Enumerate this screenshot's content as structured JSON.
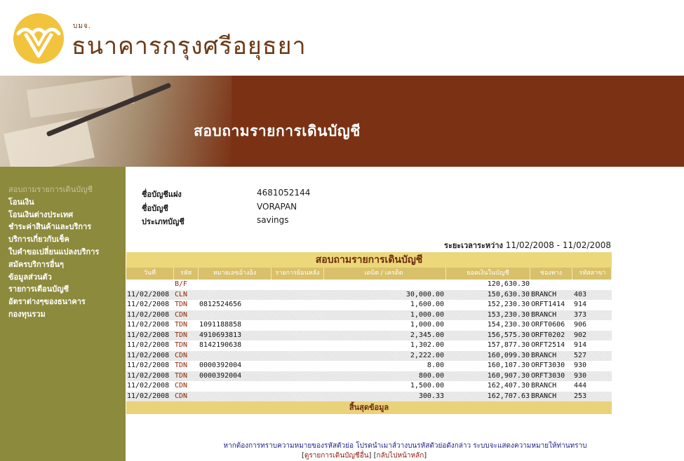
{
  "header": {
    "bank_prefix": "บมจ.",
    "bank_name": "ธนาคารกรุงศรีอยุธยา",
    "page_title": "สอบถามรายการเดินบัญชี",
    "logo_icon": "krungsri-logo-icon",
    "brand_color": "#7b3214",
    "logo_color": "#f2c33c"
  },
  "sidebar": {
    "items": [
      {
        "label": "สอบถามรายการเดินบัญชี",
        "active": true
      },
      {
        "label": "โอนเงิน"
      },
      {
        "label": "โอนเงินต่างประเทศ"
      },
      {
        "label": "ชำระค่าสินค้าและบริการ"
      },
      {
        "label": "บริการเกี่ยวกับเช็ค"
      },
      {
        "label": "ใบคำขอเปลี่ยนแปลงบริการ"
      },
      {
        "label": "สมัครบริการอื่นๆ"
      },
      {
        "label": "ข้อมูลส่วนตัว"
      },
      {
        "label": "รายการเตือนบัญชี"
      },
      {
        "label": "อัตราต่างๆของธนาคาร"
      },
      {
        "label": "กองทุนรวม"
      }
    ]
  },
  "account": {
    "nickname_label": "ชื่อบัญชีแฝง",
    "nickname_value": "4681052144",
    "name_label": "ชื่อบัญชี",
    "name_value": "VORAPAN",
    "type_label": "ประเภทบัญชี",
    "type_value": "savings"
  },
  "period": {
    "label": "ระยะเวลาระหว่าง",
    "value": "11/02/2008 - 11/02/2008"
  },
  "statement": {
    "title": "สอบถามรายการเดินบัญชี",
    "columns": [
      "วันที่",
      "รหัส",
      "หมายเลขอ้างอิง",
      "รายการย้อนหลัง",
      "เดบิต / เครดิต",
      "ยอดเงินในบัญชี",
      "ช่องทาง",
      "รหัสสาขา"
    ],
    "rows": [
      {
        "date": "",
        "code": "B/F",
        "ref": "",
        "rev": "",
        "amount": "",
        "balance": "120,630.30",
        "channel": "",
        "branch": ""
      },
      {
        "date": "11/02/2008",
        "code": "CLN",
        "ref": "",
        "rev": "",
        "amount": "30,000.00",
        "balance": "150,630.30",
        "channel": "BRANCH",
        "branch": "403"
      },
      {
        "date": "11/02/2008",
        "code": "TDN",
        "ref": "0812524656",
        "rev": "",
        "amount": "1,600.00",
        "balance": "152,230.30",
        "channel": "ORFT1414",
        "branch": "914"
      },
      {
        "date": "11/02/2008",
        "code": "CDN",
        "ref": "",
        "rev": "",
        "amount": "1,000.00",
        "balance": "153,230.30",
        "channel": "BRANCH",
        "branch": "373"
      },
      {
        "date": "11/02/2008",
        "code": "TDN",
        "ref": "1091188858",
        "rev": "",
        "amount": "1,000.00",
        "balance": "154,230.30",
        "channel": "ORFT0606",
        "branch": "906"
      },
      {
        "date": "11/02/2008",
        "code": "TDN",
        "ref": "4910693813",
        "rev": "",
        "amount": "2,345.00",
        "balance": "156,575.30",
        "channel": "ORFT0202",
        "branch": "902"
      },
      {
        "date": "11/02/2008",
        "code": "TDN",
        "ref": "8142190638",
        "rev": "",
        "amount": "1,302.00",
        "balance": "157,877.30",
        "channel": "ORFT2514",
        "branch": "914"
      },
      {
        "date": "11/02/2008",
        "code": "CDN",
        "ref": "",
        "rev": "",
        "amount": "2,222.00",
        "balance": "160,099.30",
        "channel": "BRANCH",
        "branch": "527"
      },
      {
        "date": "11/02/2008",
        "code": "TDN",
        "ref": "0000392004",
        "rev": "",
        "amount": "8.00",
        "balance": "160,107.30",
        "channel": "ORFT3030",
        "branch": "930"
      },
      {
        "date": "11/02/2008",
        "code": "TDN",
        "ref": "0000392004",
        "rev": "",
        "amount": "800.00",
        "balance": "160,907.30",
        "channel": "ORFT3030",
        "branch": "930"
      },
      {
        "date": "11/02/2008",
        "code": "CDN",
        "ref": "",
        "rev": "",
        "amount": "1,500.00",
        "balance": "162,407.30",
        "channel": "BRANCH",
        "branch": "444"
      },
      {
        "date": "11/02/2008",
        "code": "CDN",
        "ref": "",
        "rev": "",
        "amount": "300.33",
        "balance": "162,707.63",
        "channel": "BRANCH",
        "branch": "253"
      }
    ],
    "footer": "สิ้นสุดข้อมูล"
  },
  "note": "หากต้องการทราบความหมายของรหัสตัวย่อ โปรดนำเมาส์วางบนรหัสตัวย่อดังกล่าว ระบบจะแสดงความหมายให้ท่านทราบ",
  "links": {
    "other_accounts": "ดูรายการเดินบัญชีอื่น",
    "home": "กลับไปหน้าหลัก"
  }
}
